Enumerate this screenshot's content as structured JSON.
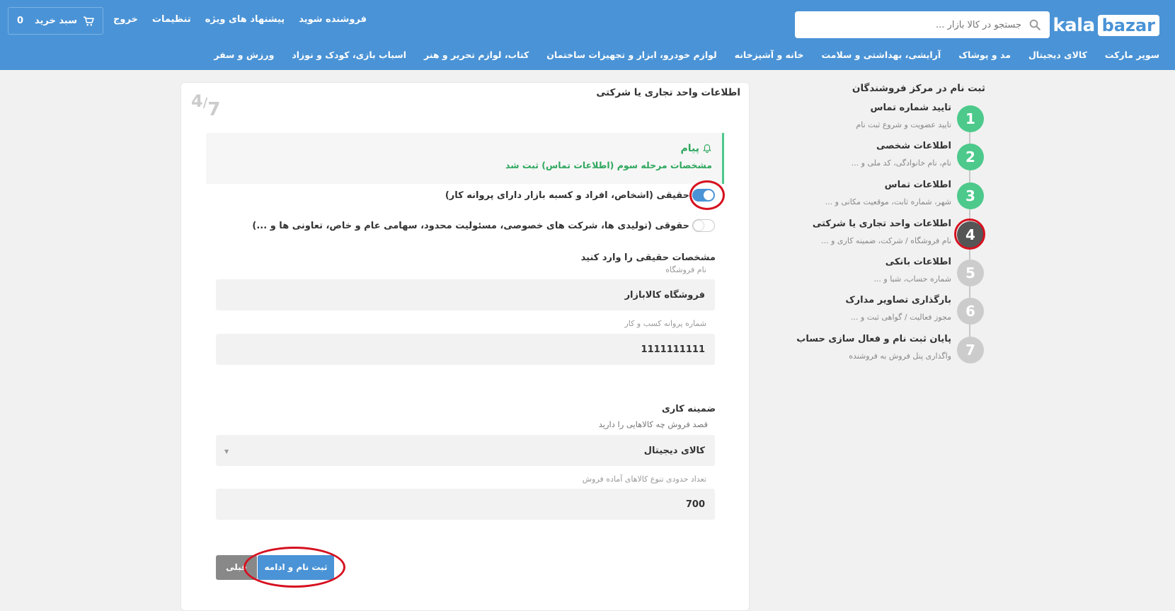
{
  "header": {
    "logo": {
      "kala": "kala",
      "bazar": "bazar"
    },
    "search": {
      "placeholder": "جستجو در کالا بازار ..."
    },
    "cart": {
      "label": "سبد خرید",
      "count": "0"
    },
    "nav": {
      "seller": "فروشنده شوید",
      "offers": "پیشنهاد های ویژه",
      "settings": "تنظیمات",
      "logout": "خروج"
    },
    "categories": [
      "سوپر مارکت",
      "کالای دیجیتال",
      "مد و پوشاک",
      "آرایشی، بهداشتی و سلامت",
      "خانه و آشپزخانه",
      "لوازم خودرو، ابزار و تجهیزات ساختمان",
      "کتاب، لوازم تحریر و هنر",
      "اسباب بازی، کودک و نوزاد",
      "ورزش و سفر"
    ],
    "colors": {
      "primary": "#4a93d6"
    }
  },
  "steps": {
    "title": "ثبت نام در مرکز فروشندگان",
    "items": [
      {
        "num": "1",
        "title": "تایید شماره تماس",
        "sub": "تایید عضویت و شروع ثبت نام",
        "status": "done"
      },
      {
        "num": "2",
        "title": "اطلاعات شخصی",
        "sub": "نام، نام خانوادگی، کد ملی و ...",
        "status": "done"
      },
      {
        "num": "3",
        "title": "اطلاعات تماس",
        "sub": "شهر، شماره ثابت، موقعیت مکانی و ...",
        "status": "done"
      },
      {
        "num": "4",
        "title": "اطلاعات واحد تجاری یا شرکتی",
        "sub": "نام فروشگاه / شرکت، ضمینه کاری و ...",
        "status": "current"
      },
      {
        "num": "5",
        "title": "اطلاعات بانکی",
        "sub": "شماره حساب، شبا و ...",
        "status": "todo"
      },
      {
        "num": "6",
        "title": "بارگذاری تصاویر مدارک",
        "sub": "مجوز فعالیت / گواهی ثبت و ...",
        "status": "todo"
      },
      {
        "num": "7",
        "title": "پایان ثبت نام و فعال سازی حساب",
        "sub": "واگذاری پنل فروش به فروشنده",
        "status": "todo"
      }
    ],
    "colors": {
      "done": "#4cc98b",
      "current": "#555555",
      "todo": "#cccccc"
    }
  },
  "form": {
    "title": "اطلاعات واحد تجاری یا شرکتی",
    "step_current": "4",
    "step_sep": "/",
    "step_total": "7",
    "alert": {
      "head": "پیام",
      "body": "مشخصات مرحله سوم (اطلاعات تماس) ثبت شد"
    },
    "options": {
      "natural": {
        "label": "حقیقی (اشخاص، افراد و کسبه بازار دارای پروانه کار)",
        "checked": true
      },
      "legal": {
        "label": "حقوقی (تولیدی ها، شرکت های خصوصی، مسئولیت محدود، سهامی عام و خاص، تعاونی ها و ...)",
        "checked": false
      }
    },
    "natural_section": {
      "title": "مشخصات حقیقی را وارد کنید",
      "store_name_label": "نام فروشگاه",
      "store_name_value": "فروشگاه کالابازار",
      "license_label": "شماره پروانه کسب و کار",
      "license_value": "1111111111"
    },
    "business_section": {
      "title": "ضمینه کاری",
      "category_label": "قصد فروش چه کالاهایی را دارید",
      "category_value": "کالای دیجیتال",
      "variety_label": "تعداد حدودی تنوع کالاهای آماده فروش",
      "variety_value": "700"
    },
    "buttons": {
      "next": "ثبت نام و ادامه",
      "prev": "قبلی"
    }
  }
}
